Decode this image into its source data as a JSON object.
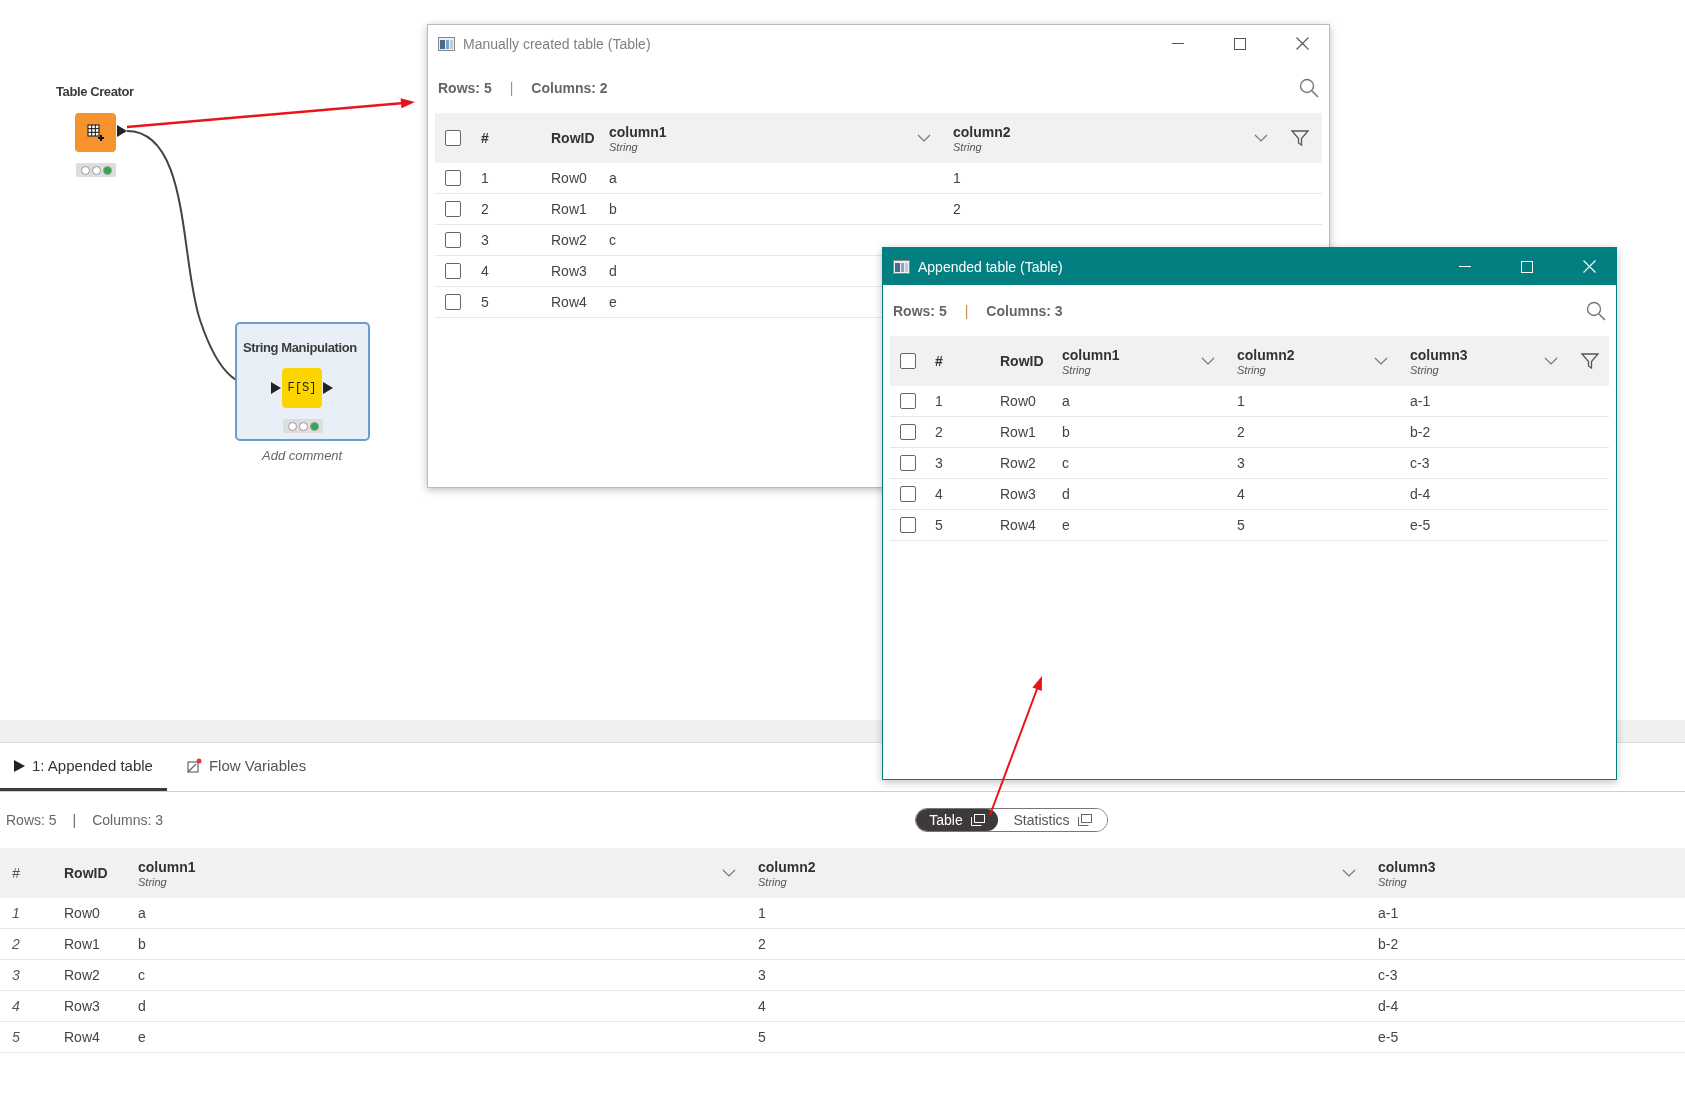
{
  "canvas": {
    "nodes": [
      {
        "kind": "table-creator",
        "label": "Table Creator",
        "lights": [
          {
            "color": "#ffffff"
          },
          {
            "color": "#ffffff"
          },
          {
            "color": "#2fa84f"
          }
        ],
        "selected": false
      },
      {
        "kind": "string-manipulation",
        "label": "String Manipulation",
        "icon_text": "F[S]",
        "lights": [
          {
            "color": "#ffffff"
          },
          {
            "color": "#ffffff"
          },
          {
            "color": "#2fa84f"
          }
        ],
        "selected": true,
        "comment": "Add comment"
      }
    ]
  },
  "windows": [
    {
      "title": "Manually created table (Table)",
      "active": false,
      "rows_label": "Rows: 5",
      "separator": "|",
      "columns_label": "Columns: 2",
      "select_all": false,
      "index_header": "#",
      "id_header": "RowID",
      "columns": [
        {
          "name": "column1",
          "type": "String"
        },
        {
          "name": "column2",
          "type": "String"
        }
      ],
      "rows": [
        {
          "checked": false,
          "index": "1",
          "id": "Row0",
          "value_1": "a",
          "value_2": "1"
        },
        {
          "checked": false,
          "index": "2",
          "id": "Row1",
          "value_1": "b",
          "value_2": "2"
        },
        {
          "checked": false,
          "index": "3",
          "id": "Row2",
          "value_1": "c"
        },
        {
          "checked": false,
          "index": "4",
          "id": "Row3",
          "value_1": "d"
        },
        {
          "checked": false,
          "index": "5",
          "id": "Row4",
          "value_1": "e"
        }
      ]
    },
    {
      "title": "Appended table (Table)",
      "active": true,
      "rows_label": "Rows: 5",
      "separator": "|",
      "columns_label": "Columns: 3",
      "select_all": false,
      "index_header": "#",
      "id_header": "RowID",
      "columns": [
        {
          "name": "column1",
          "type": "String"
        },
        {
          "name": "column2",
          "type": "String"
        },
        {
          "name": "column3",
          "type": "String"
        }
      ],
      "rows": [
        {
          "checked": false,
          "index": "1",
          "id": "Row0",
          "value_1": "a",
          "value_2": "1",
          "value_3": "a-1"
        },
        {
          "checked": false,
          "index": "2",
          "id": "Row1",
          "value_1": "b",
          "value_2": "2",
          "value_3": "b-2"
        },
        {
          "checked": false,
          "index": "3",
          "id": "Row2",
          "value_1": "c",
          "value_2": "3",
          "value_3": "c-3"
        },
        {
          "checked": false,
          "index": "4",
          "id": "Row3",
          "value_1": "d",
          "value_2": "4",
          "value_3": "d-4"
        },
        {
          "checked": false,
          "index": "5",
          "id": "Row4",
          "value_1": "e",
          "value_2": "5",
          "value_3": "e-5"
        }
      ]
    }
  ],
  "panel": {
    "tabs": [
      {
        "kind": "port",
        "label": "1: Appended table",
        "selected": true
      },
      {
        "kind": "flow",
        "label": "Flow Variables",
        "selected": false
      }
    ],
    "rows_label": "Rows: 5",
    "separator": "|",
    "columns_label": "Columns: 3",
    "views": [
      {
        "label": "Table",
        "selected": true
      },
      {
        "label": "Statistics",
        "selected": false
      }
    ],
    "table": {
      "index_header": "#",
      "id_header": "RowID",
      "columns": [
        {
          "name": "column1",
          "type": "String"
        },
        {
          "name": "column2",
          "type": "String"
        },
        {
          "name": "column3",
          "type": "String"
        }
      ],
      "rows": [
        {
          "index": "1",
          "id": "Row0",
          "cells": [
            "a",
            "1",
            "a-1"
          ]
        },
        {
          "index": "2",
          "id": "Row1",
          "cells": [
            "b",
            "2",
            "b-2"
          ]
        },
        {
          "index": "3",
          "id": "Row2",
          "cells": [
            "c",
            "3",
            "c-3"
          ]
        },
        {
          "index": "4",
          "id": "Row3",
          "cells": [
            "d",
            "4",
            "d-4"
          ]
        },
        {
          "index": "5",
          "id": "Row4",
          "cells": [
            "e",
            "5",
            "e-5"
          ]
        }
      ]
    }
  }
}
